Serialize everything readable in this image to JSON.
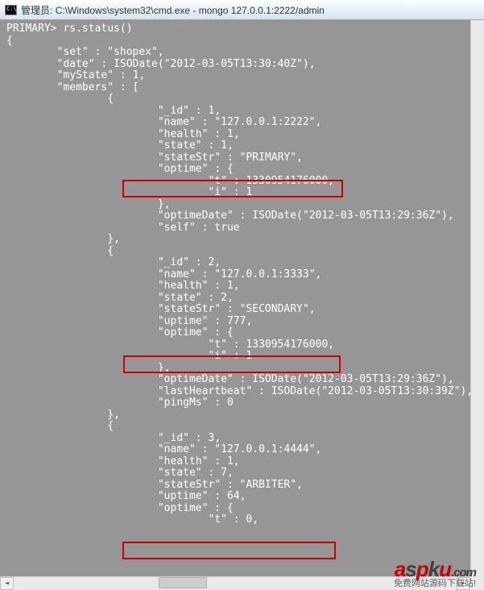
{
  "titlebar": {
    "prefix": "管理员:",
    "path": "C:\\Windows\\system32\\cmd.exe - mongo  127.0.0.1:2222/admin"
  },
  "terminal": {
    "prompt": "PRIMARY> rs.status()",
    "open_brace": "{",
    "set_key": "\"set\"",
    "set_val": "\"shopex\"",
    "date_key": "\"date\"",
    "date_val": "ISODate(\"2012-03-05T13:30:40Z\")",
    "mystate_key": "\"myState\"",
    "mystate_val": "1",
    "members_key": "\"members\"",
    "members_open": "[",
    "m1": {
      "open": "{",
      "id_key": "\"_id\"",
      "id_val": "1",
      "name_key": "\"name\"",
      "name_val": "\"127.0.0.1:2222\"",
      "health_key": "\"health\"",
      "health_val": "1",
      "state_key": "\"state\"",
      "state_val": "1",
      "statestr_key": "\"stateStr\"",
      "statestr_val": "\"PRIMARY\"",
      "optime_key": "\"optime\"",
      "optime_open": "{",
      "t_key": "\"t\"",
      "t_val": "1330954176000",
      "i_key": "\"i\"",
      "i_val": "1",
      "optime_close": "}",
      "optimedate_key": "\"optimeDate\"",
      "optimedate_val": "ISODate(\"2012-03-05T13:29:36Z\")",
      "self_key": "\"self\"",
      "self_val": "true",
      "close": "}"
    },
    "m2": {
      "open": "{",
      "id_key": "\"_id\"",
      "id_val": "2",
      "name_key": "\"name\"",
      "name_val": "\"127.0.0.1:3333\"",
      "health_key": "\"health\"",
      "health_val": "1",
      "state_key": "\"state\"",
      "state_val": "2",
      "statestr_key": "\"stateStr\"",
      "statestr_val": "\"SECONDARY\"",
      "uptime_key": "\"uptime\"",
      "uptime_val": "777",
      "optime_key": "\"optime\"",
      "optime_open": "{",
      "t_key": "\"t\"",
      "t_val": "1330954176000",
      "i_key": "\"i\"",
      "i_val": "1",
      "optime_close": "}",
      "optimedate_key": "\"optimeDate\"",
      "optimedate_val": "ISODate(\"2012-03-05T13:29:36Z\")",
      "lasthb_key": "\"lastHeartbeat\"",
      "lasthb_val": "ISODate(\"2012-03-05T13:30:39Z\")",
      "pingms_key": "\"pingMs\"",
      "pingms_val": "0",
      "close": "}"
    },
    "m3": {
      "open": "{",
      "id_key": "\"_id\"",
      "id_val": "3",
      "name_key": "\"name\"",
      "name_val": "\"127.0.0.1:4444\"",
      "health_key": "\"health\"",
      "health_val": "1",
      "state_key": "\"state\"",
      "state_val": "7",
      "statestr_key": "\"stateStr\"",
      "statestr_val": "\"ARBITER\"",
      "uptime_key": "\"uptime\"",
      "uptime_val": "64",
      "optime_key": "\"optime\"",
      "optime_open": "{",
      "t_key": "\"t\"",
      "t_val": "0"
    }
  },
  "watermark": {
    "main_a": "a",
    "main_s": "s",
    "main_p": "p",
    "main_k": "k",
    "main_u": "u",
    "main_dot": ".com",
    "sub": "免费网站源码下载站!"
  }
}
